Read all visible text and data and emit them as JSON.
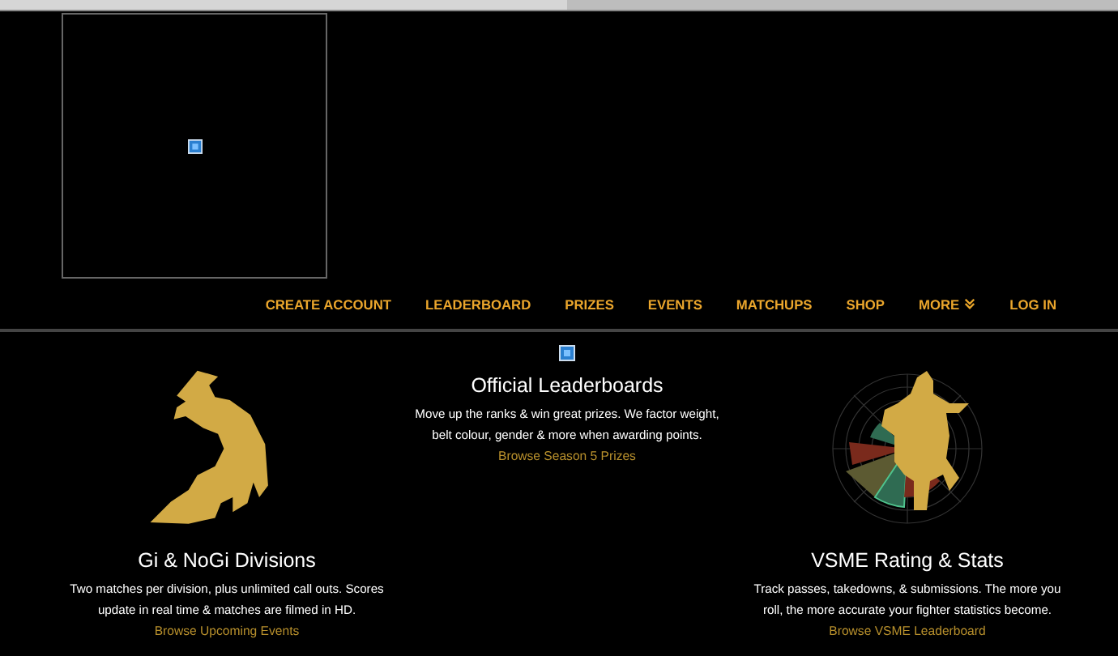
{
  "nav": [
    {
      "label": "CREATE ACCOUNT",
      "kind": "link"
    },
    {
      "label": "LEADERBOARD",
      "kind": "link"
    },
    {
      "label": "PRIZES",
      "kind": "link"
    },
    {
      "label": "EVENTS",
      "kind": "link"
    },
    {
      "label": "MATCHUPS",
      "kind": "link"
    },
    {
      "label": "SHOP",
      "kind": "link"
    },
    {
      "label": "MORE",
      "kind": "dropdown"
    },
    {
      "label": "LOG IN",
      "kind": "link"
    }
  ],
  "features": [
    {
      "kind": "grappling",
      "title": "Gi & NoGi Divisions",
      "text": "Two matches per division, plus unlimited call outs. Scores update in real time & matches are filmed in HD.",
      "link": "Browse Upcoming Events"
    },
    {
      "kind": "broken",
      "title": "Official Leaderboards",
      "text": "Move up the ranks & win great prizes. We factor weight, belt colour, gender & more when awarding points.",
      "link": "Browse Season 5 Prizes"
    },
    {
      "kind": "stats",
      "title": "VSME Rating & Stats",
      "text": "Track passes, takedowns, & submissions. The more you roll, the more accurate your fighter statistics become.",
      "link": "Browse VSME Leaderboard"
    }
  ]
}
